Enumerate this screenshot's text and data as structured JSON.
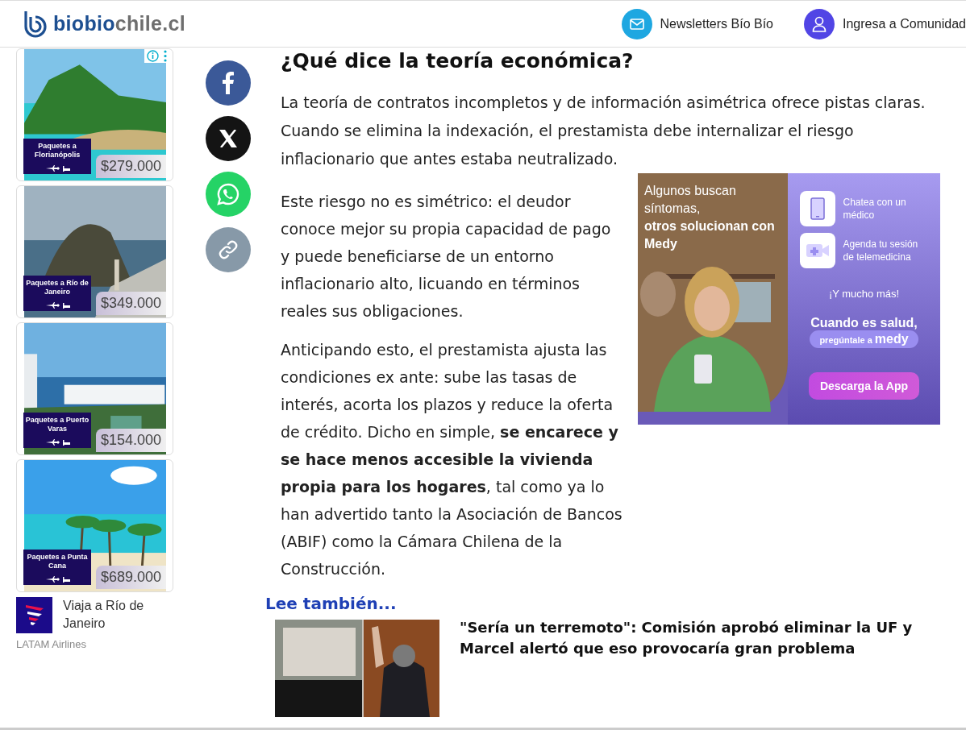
{
  "header": {
    "logo": {
      "primary": "biobio",
      "secondary": "chile.cl"
    },
    "links": [
      {
        "kind": "mail",
        "label": "Newsletters Bío Bío"
      },
      {
        "kind": "user",
        "label": "Ingresa a Comunidad"
      }
    ]
  },
  "side_ads": [
    {
      "caption": "Paquetes a Florianópolis",
      "price": "$279.000"
    },
    {
      "caption": "Paquetes a Río de Janeiro",
      "price": "$349.000"
    },
    {
      "caption": "Paquetes a Puerto Varas",
      "price": "$154.000"
    },
    {
      "caption": "Paquetes a Punta Cana",
      "price": "$689.000"
    }
  ],
  "sponsor": {
    "title": "Viaja a Río de Janeiro",
    "advertiser": "LATAM Airlines"
  },
  "share_buttons": [
    {
      "kind": "facebook"
    },
    {
      "kind": "x"
    },
    {
      "kind": "whatsapp"
    },
    {
      "kind": "link"
    }
  ],
  "article": {
    "heading": "¿Qué dice la teoría económica?",
    "paragraphs": [
      "La teoría de contratos incompletos y de información asimétrica ofrece pistas claras. Cuando se elimina la indexación, el prestamista debe internalizar el riesgo inflacionario que antes estaba neutralizado.",
      "Este riesgo no es simétrico: el deudor conoce mejor su propia capacidad de pago y puede beneficiarse de un entorno inflacionario alto, licuando en términos reales sus obligaciones.",
      "Anticipando esto, el prestamista ajusta las condiciones ex ante: sube las tasas de interés, acorta los plazos y reduce la oferta de crédito. Dicho en simple, **se encarece y se hace menos accesible la vivienda propia para los hogares**, tal como ya lo han advertido tanto la Asociación de Bancos (ABIF) como la Cámara Chilena de la Construcción."
    ],
    "ad": {
      "headline": "Algunos buscan síntomas,",
      "headline_bold": "otros solucionan con Medy",
      "features": [
        {
          "kind": "phone",
          "text": "Chatea con un médico"
        },
        {
          "kind": "video",
          "text": "Agenda tu sesión de telemedicina"
        }
      ],
      "more": "¡Y mucho más!",
      "tagline": "Cuando es salud,",
      "pill": "pregúntale a",
      "brand": "medy",
      "button": "Descarga la App"
    }
  },
  "related": {
    "label": "Lee también...",
    "title": "\"Sería un terremoto\": Comisión aprobó eliminar la UF y Marcel alertó que eso provocaría gran problema"
  }
}
